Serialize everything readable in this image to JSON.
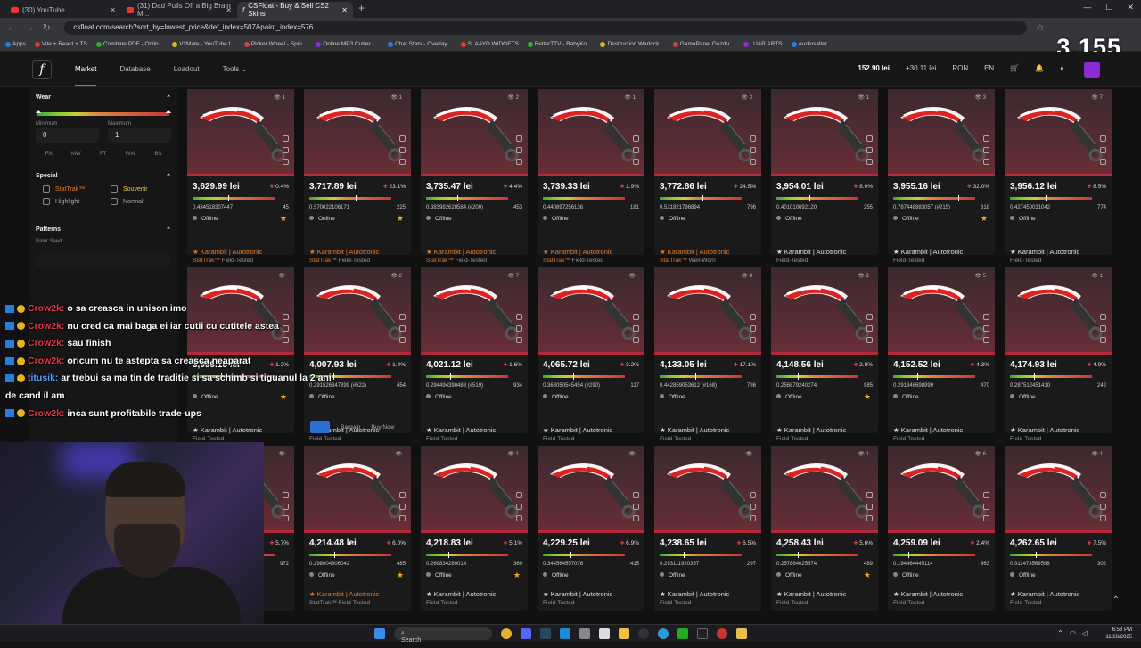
{
  "browser": {
    "tabs": [
      {
        "label": "(30) YouTube"
      },
      {
        "label": "(31) Dad Pulls Off a Big Brain M..."
      },
      {
        "label": "CSFloat - Buy & Sell CS2 Skins"
      }
    ],
    "url": "csfloat.com/search?sort_by=lowest_price&def_index=507&paint_index=576",
    "bookmarks": [
      "Apps",
      "Vite + React + TS",
      "Combine PDF - Onlin...",
      "V2Mate - YouTube t...",
      "Picker Wheel - Spin...",
      "Online MP3 Cutter -...",
      "Chat Stats - Overlay...",
      "SLAAYD WIDGETS",
      "BetterTTV - BabyKo...",
      "Destruction Warlock...",
      "GamePanel Gazdu...",
      "LUAR ARTS",
      "Audiosalter"
    ]
  },
  "viewer_count": "3,155",
  "nav": {
    "market": "Market",
    "database": "Database",
    "loadout": "Loadout",
    "tools": "Tools",
    "balance": "152.90 lei",
    "pending": "+30.11 lei",
    "currency": "RON",
    "lang": "EN"
  },
  "sidebar": {
    "wear_title": "Wear",
    "min_label": "Minimum",
    "max_label": "Maximum",
    "min_value": "0",
    "max_value": "1",
    "wears": [
      "FN",
      "MW",
      "FT",
      "WW",
      "BS"
    ],
    "special_title": "Special",
    "stattrak": "StatTrak™",
    "souvenir": "Souvenir",
    "highlight": "Highlight",
    "normal": "Normal",
    "patterns_title": "Patterns",
    "paint_seed": "Paint Seed"
  },
  "cards": [
    {
      "name": "",
      "sub": "",
      "price": "3,629.99 lei",
      "pct": "0.4%",
      "float": "0.434518307447",
      "seed": "45",
      "status": "Offline",
      "count": "1",
      "wear": 0.43,
      "star": true
    },
    {
      "name": "",
      "sub": "",
      "price": "3,717.89 lei",
      "pct": "23.1%",
      "float": "0.570022106171",
      "seed": "225",
      "status": "Online",
      "count": "1",
      "wear": 0.57,
      "star": true
    },
    {
      "name": "",
      "sub": "",
      "price": "3,735.47 lei",
      "pct": "4.4%",
      "float": "0.383982628584 (#200)",
      "seed": "453",
      "status": "Offline",
      "count": "2",
      "wear": 0.38,
      "star": false
    },
    {
      "name": "",
      "sub": "",
      "price": "3,739.33 lei",
      "pct": "2.9%",
      "float": "0.440897256136",
      "seed": "181",
      "status": "Offline",
      "count": "1",
      "wear": 0.44,
      "star": false
    },
    {
      "name": "",
      "sub": "",
      "price": "3,772.86 lei",
      "pct": "24.5%",
      "float": "0.521821796894",
      "seed": "796",
      "status": "Offline",
      "count": "3",
      "wear": 0.52,
      "star": false
    },
    {
      "name": "",
      "sub": "",
      "price": "3,954.01 lei",
      "pct": "8.0%",
      "float": "0.401010692120",
      "seed": "255",
      "status": "Offline",
      "count": "1",
      "wear": 0.4,
      "star": false
    },
    {
      "name": "",
      "sub": "",
      "price": "3,955.16 lei",
      "pct": "32.0%",
      "float": "0.787448883057 (#215)",
      "seed": "818",
      "status": "Offline",
      "count": "3",
      "wear": 0.79,
      "star": true
    },
    {
      "name": "",
      "sub": "",
      "price": "3,956.12 lei",
      "pct": "8.5%",
      "float": "0.427450031042",
      "seed": "774",
      "status": "Offline",
      "count": "7",
      "wear": 0.43,
      "star": false
    },
    {
      "name": "★ Karambit | Autotronic",
      "sub": "StatTrak™ Field-Tested",
      "price": "3,999.15 lei",
      "pct": "1.2%",
      "float": "",
      "seed": "",
      "status": "Offline",
      "count": "",
      "wear": 0.35,
      "star": true,
      "st": true
    },
    {
      "name": "★ Karambit | Autotronic",
      "sub": "StatTrak™ Field-Tested",
      "price": "4,007.93 lei",
      "pct": "1.4%",
      "float": "0.291526347399 (#522)",
      "seed": "454",
      "status": "Offline",
      "count": "2",
      "wear": 0.29,
      "star": false,
      "st": true
    },
    {
      "name": "★ Karambit | Autotronic",
      "sub": "StatTrak™ Field-Tested",
      "price": "4,021.12 lei",
      "pct": "1.6%",
      "float": "0.294494390488 (#519)",
      "seed": "934",
      "status": "Offline",
      "count": "7",
      "wear": 0.29,
      "star": false,
      "st": true
    },
    {
      "name": "★ Karambit | Autotronic",
      "sub": "StatTrak™ Field-Tested",
      "price": "4,065.72 lei",
      "pct": "3.2%",
      "float": "0.368050545454 (#290)",
      "seed": "117",
      "status": "Offline",
      "count": "",
      "wear": 0.37,
      "star": false,
      "st": true
    },
    {
      "name": "★ Karambit | Autotronic",
      "sub": "StatTrak™ Well-Worn",
      "price": "4,133.05 lei",
      "pct": "17.1%",
      "float": "0.442859053612 (#168)",
      "seed": "786",
      "status": "Offline",
      "count": "8",
      "wear": 0.44,
      "star": false,
      "st": true
    },
    {
      "name": "★ Karambit | Autotronic",
      "sub": "Field-Tested",
      "price": "4,148.56 lei",
      "pct": "2.8%",
      "float": "0.256879240274",
      "seed": "985",
      "status": "Offline",
      "count": "2",
      "wear": 0.26,
      "star": true
    },
    {
      "name": "★ Karambit | Autotronic",
      "sub": "Field-Tested",
      "price": "4,152.52 lei",
      "pct": "4.3%",
      "float": "0.291346698999",
      "seed": "470",
      "status": "Offline",
      "count": "5",
      "wear": 0.29,
      "star": false
    },
    {
      "name": "★ Karambit | Autotronic",
      "sub": "Field-Tested",
      "price": "4,174.93 lei",
      "pct": "4.9%",
      "float": "0.287512451410",
      "seed": "242",
      "status": "Offline",
      "count": "1",
      "wear": 0.29,
      "star": false
    },
    {
      "name": "★ Karambit | Autotronic",
      "sub": "Field-Tested",
      "price": "",
      "pct": "5.7%",
      "float": "",
      "seed": "972",
      "status": "",
      "count": "",
      "wear": 0.3,
      "star": false
    },
    {
      "name": "★ Karambit | Autotronic",
      "sub": "Field-Tested",
      "price": "4,214.48 lei",
      "pct": "6.0%",
      "float": "0.298004806042",
      "seed": "485",
      "status": "Offline",
      "count": "",
      "wear": 0.3,
      "star": true
    },
    {
      "name": "★ Karambit | Autotronic",
      "sub": "Field-Tested",
      "price": "4,218.83 lei",
      "pct": "5.1%",
      "float": "0.269834280014",
      "seed": "369",
      "status": "Offline",
      "count": "1",
      "wear": 0.27,
      "star": true
    },
    {
      "name": "★ Karambit | Autotronic",
      "sub": "Field-Tested",
      "price": "4,229.25 lei",
      "pct": "6.9%",
      "float": "0.344564557076",
      "seed": "415",
      "status": "Offline",
      "count": "",
      "wear": 0.34,
      "star": false
    },
    {
      "name": "★ Karambit | Autotronic",
      "sub": "Field-Tested",
      "price": "4,238.65 lei",
      "pct": "6.5%",
      "float": "0.293111920357",
      "seed": "297",
      "status": "Offline",
      "count": "",
      "wear": 0.29,
      "star": false
    },
    {
      "name": "★ Karambit | Autotronic",
      "sub": "Field-Tested",
      "price": "4,258.43 lei",
      "pct": "5.6%",
      "float": "0.257884025574",
      "seed": "489",
      "status": "Offline",
      "count": "1",
      "wear": 0.26,
      "star": true
    },
    {
      "name": "★ Karambit | Autotronic",
      "sub": "Field-Tested",
      "price": "4,259.09 lei",
      "pct": "2.4%",
      "float": "0.194464445114",
      "seed": "963",
      "status": "Offline",
      "count": "6",
      "wear": 0.19,
      "star": false
    },
    {
      "name": "★ Karambit | Autotronic",
      "sub": "Field-Tested",
      "price": "4,262.65 lei",
      "pct": "7.5%",
      "float": "0.311473569598",
      "seed": "302",
      "status": "Offline",
      "count": "1",
      "wear": 0.31,
      "star": false
    }
  ],
  "bottom_titles": [
    "★ Karambit | Autotronic",
    "★ Karambit | Autotronic",
    "★ Karambit | Autotronic",
    "★ Karambit | Autotronic",
    "★ Karambit | Autotronic",
    "★ Karambit | Autotronic",
    "★ Karambit | Autotronic"
  ],
  "bottom_subs": [
    "StatTrak™ Field-Tested",
    "Field-Tested",
    "Field-Tested",
    "Field-Tested",
    "Field-Tested",
    "Field-Tested",
    "Field-Tested"
  ],
  "popup": {
    "bargain": "Bargain",
    "buy": "Buy Now"
  },
  "chat": [
    {
      "user": "Crow2k:",
      "text": "o sa creasca in unison imo"
    },
    {
      "user": "Crow2k:",
      "text": "nu cred ca mai baga ei iar cutii cu cutitele astea"
    },
    {
      "user": "Crow2k:",
      "text": "sau finish"
    },
    {
      "user": "Crow2k:",
      "text": "oricum nu te astepta sa creasca neaparat"
    },
    {
      "user": "titusik:",
      "text": "ar trebui sa ma tin de traditie si sa schimb si tiguanul la 2 ani de cand il am"
    },
    {
      "user": "Crow2k:",
      "text": "inca sunt profitabile trade-ups"
    }
  ],
  "taskbar": {
    "search": "Search",
    "time": "6:58 PM",
    "date": "11/28/2025"
  }
}
